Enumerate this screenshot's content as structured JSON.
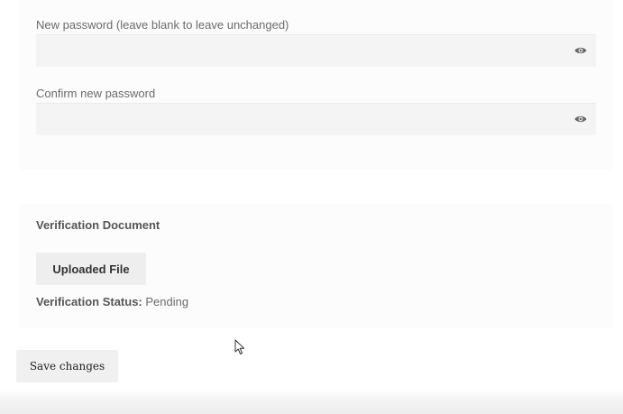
{
  "password": {
    "new_label": "New password (leave blank to leave unchanged)",
    "new_value": "",
    "new_toggle_icon": "eye-icon",
    "confirm_label": "Confirm new password",
    "confirm_value": "",
    "confirm_toggle_icon": "eye-icon"
  },
  "verification": {
    "title": "Verification Document",
    "uploaded_button_label": "Uploaded File",
    "status_label": "Verification Status:",
    "status_value": "Pending"
  },
  "actions": {
    "save_label": "Save changes"
  },
  "cursor": {
    "icon": "mouse-pointer-icon"
  }
}
